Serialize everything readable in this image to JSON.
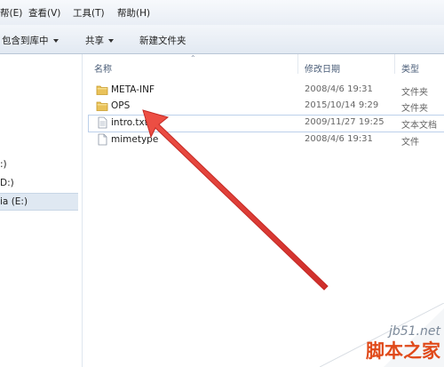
{
  "menu": {
    "items": [
      "帮(E)",
      "查看(V)",
      "工具(T)",
      "帮助(H)"
    ]
  },
  "toolbar": {
    "include_label": "包含到库中",
    "share_label": "共享",
    "new_folder_label": "新建文件夹"
  },
  "nav": {
    "drives": [
      ":)",
      "D:)",
      "ia (E:)"
    ],
    "selected_index": 2
  },
  "columns": {
    "name": "名称",
    "modified": "修改日期",
    "type": "类型"
  },
  "files": [
    {
      "name": "META-INF",
      "modified": "2008/4/6 19:31",
      "type": "文件夹",
      "icon": "folder-icon"
    },
    {
      "name": "OPS",
      "modified": "2015/10/14 9:29",
      "type": "文件夹",
      "icon": "folder-icon"
    },
    {
      "name": "intro.txt",
      "modified": "2009/11/27 19:25",
      "type": "文本文档",
      "icon": "text-file-icon"
    },
    {
      "name": "mimetype",
      "modified": "2008/4/6 19:31",
      "type": "文件",
      "icon": "file-icon"
    }
  ],
  "colors": {
    "arrow": "#e23b36",
    "selection": "#dfe8f2",
    "watermark_accent": "#e04a1a"
  },
  "watermark": {
    "site": "jb51.net",
    "brand": "脚本之家"
  }
}
